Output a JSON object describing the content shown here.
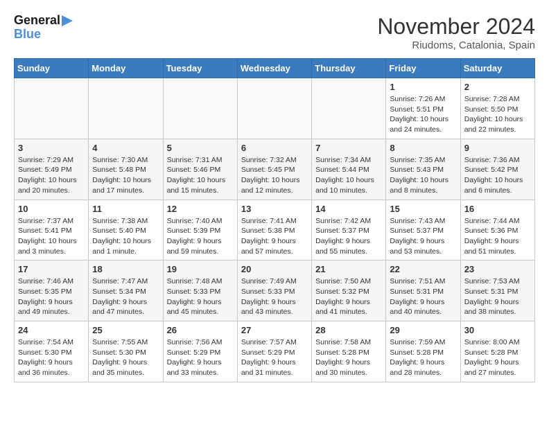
{
  "logo": {
    "line1": "General",
    "line2": "Blue"
  },
  "title": "November 2024",
  "location": "Riudoms, Catalonia, Spain",
  "days_of_week": [
    "Sunday",
    "Monday",
    "Tuesday",
    "Wednesday",
    "Thursday",
    "Friday",
    "Saturday"
  ],
  "weeks": [
    [
      {
        "day": "",
        "info": ""
      },
      {
        "day": "",
        "info": ""
      },
      {
        "day": "",
        "info": ""
      },
      {
        "day": "",
        "info": ""
      },
      {
        "day": "",
        "info": ""
      },
      {
        "day": "1",
        "info": "Sunrise: 7:26 AM\nSunset: 5:51 PM\nDaylight: 10 hours and 24 minutes."
      },
      {
        "day": "2",
        "info": "Sunrise: 7:28 AM\nSunset: 5:50 PM\nDaylight: 10 hours and 22 minutes."
      }
    ],
    [
      {
        "day": "3",
        "info": "Sunrise: 7:29 AM\nSunset: 5:49 PM\nDaylight: 10 hours and 20 minutes."
      },
      {
        "day": "4",
        "info": "Sunrise: 7:30 AM\nSunset: 5:48 PM\nDaylight: 10 hours and 17 minutes."
      },
      {
        "day": "5",
        "info": "Sunrise: 7:31 AM\nSunset: 5:46 PM\nDaylight: 10 hours and 15 minutes."
      },
      {
        "day": "6",
        "info": "Sunrise: 7:32 AM\nSunset: 5:45 PM\nDaylight: 10 hours and 12 minutes."
      },
      {
        "day": "7",
        "info": "Sunrise: 7:34 AM\nSunset: 5:44 PM\nDaylight: 10 hours and 10 minutes."
      },
      {
        "day": "8",
        "info": "Sunrise: 7:35 AM\nSunset: 5:43 PM\nDaylight: 10 hours and 8 minutes."
      },
      {
        "day": "9",
        "info": "Sunrise: 7:36 AM\nSunset: 5:42 PM\nDaylight: 10 hours and 6 minutes."
      }
    ],
    [
      {
        "day": "10",
        "info": "Sunrise: 7:37 AM\nSunset: 5:41 PM\nDaylight: 10 hours and 3 minutes."
      },
      {
        "day": "11",
        "info": "Sunrise: 7:38 AM\nSunset: 5:40 PM\nDaylight: 10 hours and 1 minute."
      },
      {
        "day": "12",
        "info": "Sunrise: 7:40 AM\nSunset: 5:39 PM\nDaylight: 9 hours and 59 minutes."
      },
      {
        "day": "13",
        "info": "Sunrise: 7:41 AM\nSunset: 5:38 PM\nDaylight: 9 hours and 57 minutes."
      },
      {
        "day": "14",
        "info": "Sunrise: 7:42 AM\nSunset: 5:37 PM\nDaylight: 9 hours and 55 minutes."
      },
      {
        "day": "15",
        "info": "Sunrise: 7:43 AM\nSunset: 5:37 PM\nDaylight: 9 hours and 53 minutes."
      },
      {
        "day": "16",
        "info": "Sunrise: 7:44 AM\nSunset: 5:36 PM\nDaylight: 9 hours and 51 minutes."
      }
    ],
    [
      {
        "day": "17",
        "info": "Sunrise: 7:46 AM\nSunset: 5:35 PM\nDaylight: 9 hours and 49 minutes."
      },
      {
        "day": "18",
        "info": "Sunrise: 7:47 AM\nSunset: 5:34 PM\nDaylight: 9 hours and 47 minutes."
      },
      {
        "day": "19",
        "info": "Sunrise: 7:48 AM\nSunset: 5:33 PM\nDaylight: 9 hours and 45 minutes."
      },
      {
        "day": "20",
        "info": "Sunrise: 7:49 AM\nSunset: 5:33 PM\nDaylight: 9 hours and 43 minutes."
      },
      {
        "day": "21",
        "info": "Sunrise: 7:50 AM\nSunset: 5:32 PM\nDaylight: 9 hours and 41 minutes."
      },
      {
        "day": "22",
        "info": "Sunrise: 7:51 AM\nSunset: 5:31 PM\nDaylight: 9 hours and 40 minutes."
      },
      {
        "day": "23",
        "info": "Sunrise: 7:53 AM\nSunset: 5:31 PM\nDaylight: 9 hours and 38 minutes."
      }
    ],
    [
      {
        "day": "24",
        "info": "Sunrise: 7:54 AM\nSunset: 5:30 PM\nDaylight: 9 hours and 36 minutes."
      },
      {
        "day": "25",
        "info": "Sunrise: 7:55 AM\nSunset: 5:30 PM\nDaylight: 9 hours and 35 minutes."
      },
      {
        "day": "26",
        "info": "Sunrise: 7:56 AM\nSunset: 5:29 PM\nDaylight: 9 hours and 33 minutes."
      },
      {
        "day": "27",
        "info": "Sunrise: 7:57 AM\nSunset: 5:29 PM\nDaylight: 9 hours and 31 minutes."
      },
      {
        "day": "28",
        "info": "Sunrise: 7:58 AM\nSunset: 5:28 PM\nDaylight: 9 hours and 30 minutes."
      },
      {
        "day": "29",
        "info": "Sunrise: 7:59 AM\nSunset: 5:28 PM\nDaylight: 9 hours and 28 minutes."
      },
      {
        "day": "30",
        "info": "Sunrise: 8:00 AM\nSunset: 5:28 PM\nDaylight: 9 hours and 27 minutes."
      }
    ]
  ]
}
